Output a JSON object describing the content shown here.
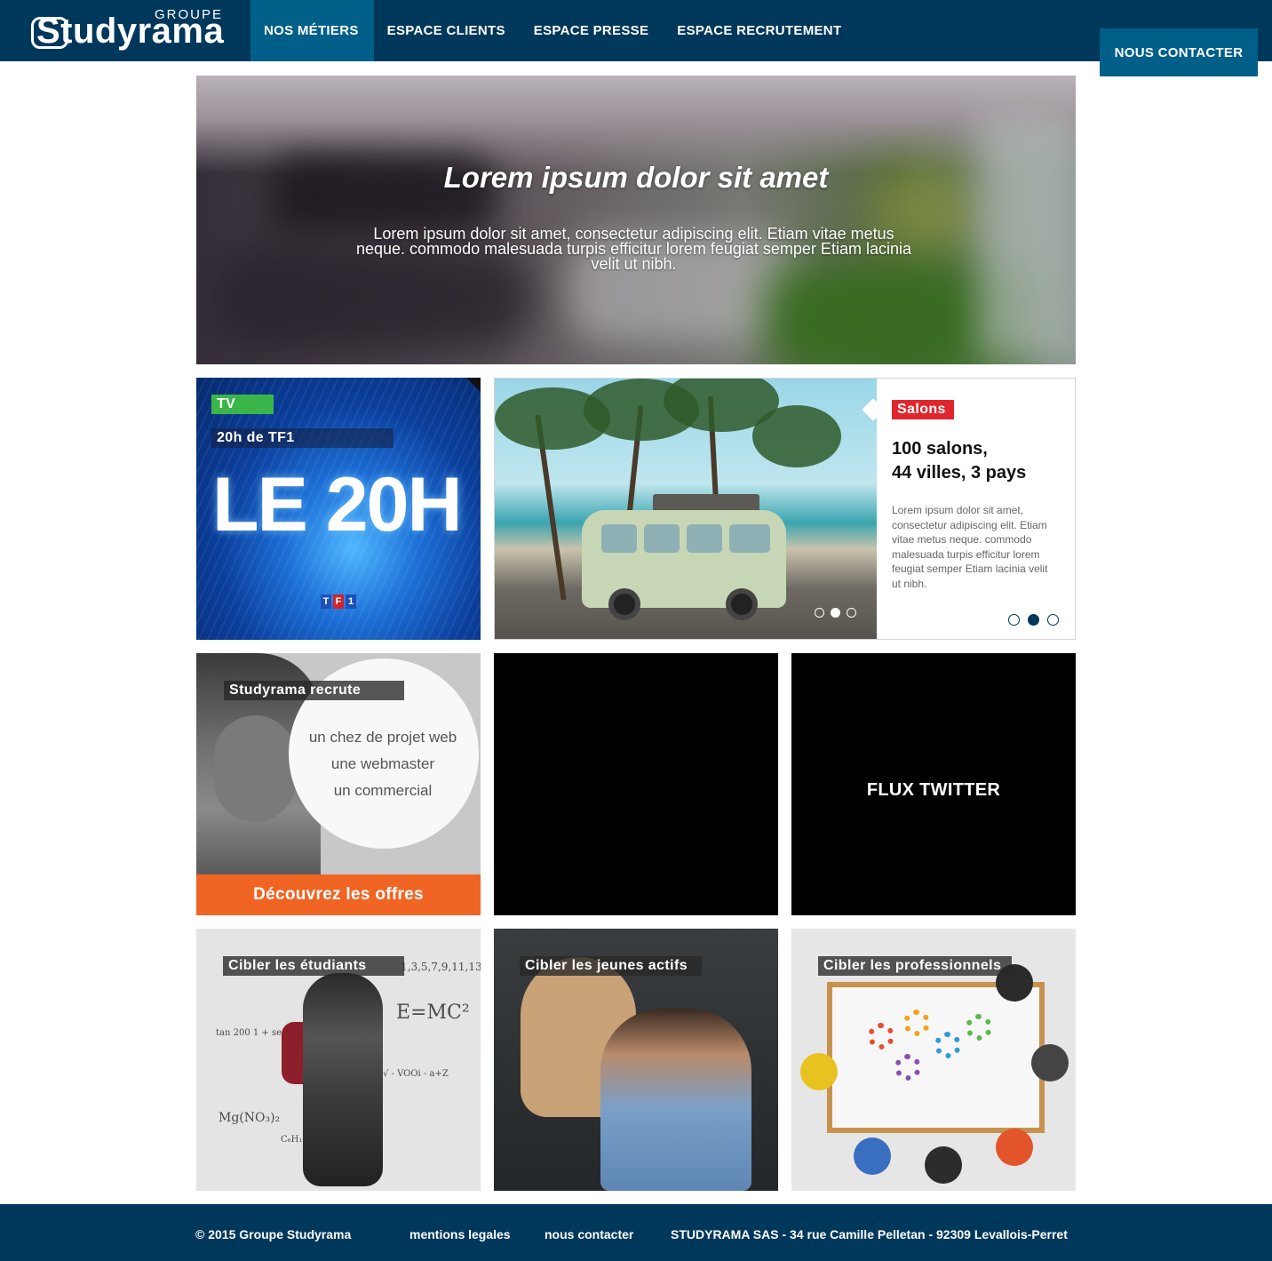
{
  "header": {
    "logo_groupe": "GROUPE",
    "logo_word": "Studyrama",
    "nav": [
      "NOS MÉTIERS",
      "ESPACE CLIENTS",
      "ESPACE PRESSE",
      "ESPACE RECRUTEMENT"
    ],
    "active_nav": "NOS MÉTIERS",
    "contact_button": "NOUS CONTACTER"
  },
  "hero": {
    "title": "Lorem ipsum dolor sit amet",
    "text": "Lorem ipsum dolor sit amet, consectetur adipiscing elit. Etiam vitae metus neque. commodo malesuada turpis efficitur lorem feugiat semper Etiam lacinia velit ut nibh."
  },
  "tv_tile": {
    "tag": "TV",
    "subtitle": "20h de TF1",
    "logo_text": "LE 20H",
    "channel": [
      "T",
      "F",
      "1"
    ]
  },
  "salons_tile": {
    "tag": "Salons",
    "title": "100 salons,\n44 villes, 3 pays",
    "text": "Lorem ipsum dolor sit amet, consectetur adipiscing elit. Etiam vitae metus neque. commodo malesuada turpis efficitur lorem feugiat semper Etiam lacinia velit ut nibh.",
    "carousel_active": 2,
    "carousel_count": 3
  },
  "recrute_tile": {
    "tag": "Studyrama recrute",
    "jobs": [
      "un chez de projet web",
      "une webmaster",
      "un commercial"
    ],
    "cta": "Découvrez les offres"
  },
  "twitter_tile": {
    "label": "FLUX TWITTER"
  },
  "cible_tiles": [
    {
      "label": "Cibler les étudiants"
    },
    {
      "label": "Cibler les jeunes actifs"
    },
    {
      "label": "Cibler les professionnels"
    }
  ],
  "footer": {
    "copyright": "© 2015 Groupe Studyrama",
    "mentions": "mentions legales",
    "contact": "nous contacter",
    "address": "STUDYRAMA SAS - 34 rue Camille Pelletan - 92309 Levallois-Perret"
  },
  "colors": {
    "navy": "#00385b",
    "blue_active": "#005f88",
    "orange": "#f06524",
    "red": "#e0262c",
    "green": "#3ab54a"
  }
}
